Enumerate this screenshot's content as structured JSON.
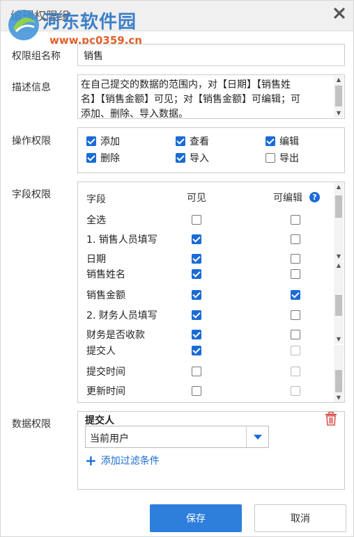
{
  "dialog": {
    "title": "编辑权限组"
  },
  "watermark": {
    "name": "河东软件园",
    "url": "www.pc0359.cn"
  },
  "group_name": {
    "label": "权限组名称",
    "value": "销售"
  },
  "description": {
    "label": "描述信息",
    "lines": [
      "在自己提交的数据的范围内，对【日期】【销售姓",
      "名】【销售金额】可见；对【销售金额】可编辑；可",
      "添加、删除、导入数据。"
    ]
  },
  "operation": {
    "label": "操作权限",
    "items": [
      {
        "label": "添加",
        "checked": true
      },
      {
        "label": "查看",
        "checked": true
      },
      {
        "label": "编辑",
        "checked": true
      },
      {
        "label": "删除",
        "checked": true
      },
      {
        "label": "导入",
        "checked": true
      },
      {
        "label": "导出",
        "checked": false
      }
    ]
  },
  "fields": {
    "label": "字段权限",
    "col_field": "字段",
    "col_visible": "可见",
    "col_editable": "可编辑",
    "help_glyph": "?",
    "rows": [
      {
        "name": "全选",
        "visible": "off",
        "editable": "off"
      },
      {
        "name": "1. 销售人员填写",
        "visible": "on",
        "editable": "off"
      },
      {
        "name": "日期",
        "visible": "on",
        "editable": "off"
      },
      {
        "name": "销售姓名",
        "visible": "on",
        "editable": "off"
      },
      {
        "name": "销售金额",
        "visible": "on",
        "editable": "on"
      },
      {
        "name": "2. 财务人员填写",
        "visible": "on",
        "editable": "off"
      },
      {
        "name": "财务是否收款",
        "visible": "on",
        "editable": "off"
      },
      {
        "name": "提交人",
        "visible": "on",
        "editable": "dis"
      },
      {
        "name": "提交时间",
        "visible": "off",
        "editable": "dis"
      },
      {
        "name": "更新时间",
        "visible": "off",
        "editable": "dis"
      }
    ]
  },
  "data_permission": {
    "label": "数据权限",
    "field_name": "提交人",
    "select_value": "当前用户",
    "add_filter_label": "添加过滤条件",
    "add_glyph": "+"
  },
  "buttons": {
    "save": "保存",
    "cancel": "取消"
  },
  "colors": {
    "accent": "#1a6bd6",
    "primary_button": "#2d7fdb",
    "delete": "#d9534f"
  }
}
